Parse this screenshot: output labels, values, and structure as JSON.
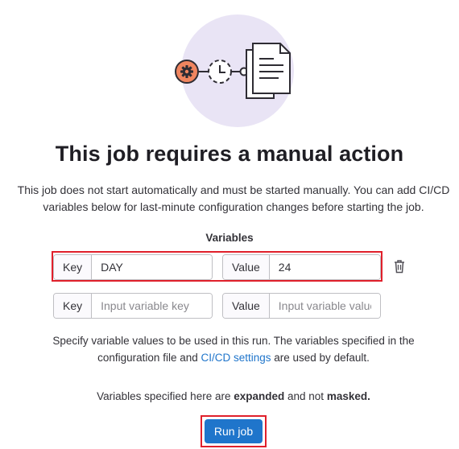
{
  "title": "This job requires a manual action",
  "description": "This job does not start automatically and must be started manually. You can add CI/CD variables below for last-minute configuration changes before starting the job.",
  "variables_label": "Variables",
  "variable_rows": [
    {
      "key_label": "Key",
      "key_value": "DAY",
      "key_placeholder": "",
      "value_label": "Value",
      "value_value": "24",
      "value_placeholder": ""
    },
    {
      "key_label": "Key",
      "key_value": "",
      "key_placeholder": "Input variable key",
      "value_label": "Value",
      "value_value": "",
      "value_placeholder": "Input variable value"
    }
  ],
  "help": {
    "part1": "Specify variable values to be used in this run. The variables specified in the configuration file and ",
    "link": "CI/CD settings",
    "part2": " are used by default."
  },
  "note": {
    "part1": "Variables specified here are ",
    "bold1": "expanded",
    "part2": " and not ",
    "bold2": "masked."
  },
  "run_button_label": "Run job",
  "icons": [
    "gear-icon",
    "clock-icon",
    "document-icon",
    "trash-icon"
  ],
  "colors": {
    "accent": "#1f75cb",
    "highlight": "#e0202b",
    "illustration_bg": "#e9e4f5",
    "gear_fill": "#f0855f"
  }
}
